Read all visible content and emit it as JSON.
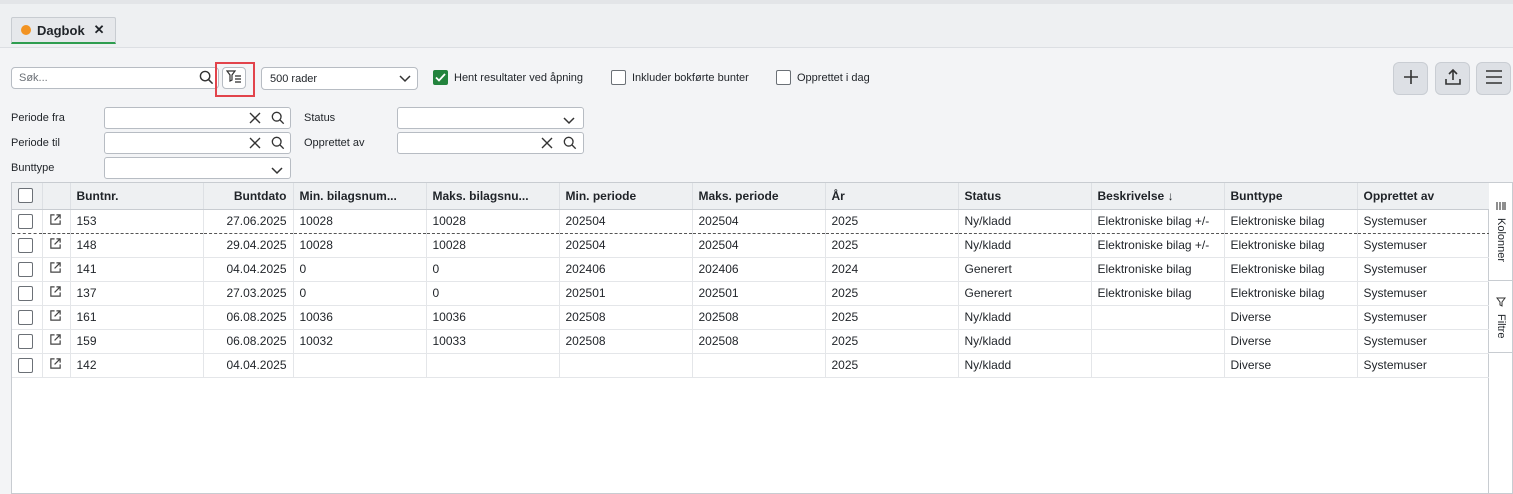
{
  "tab": {
    "label": "Dagbok",
    "close": "✕",
    "dot_color": "#f29322"
  },
  "toolbar": {
    "search_placeholder": "Søk...",
    "rows_select": "500 rader",
    "cb_fetch": {
      "label": "Hent resultater ved åpning",
      "checked": true
    },
    "cb_include": {
      "label": "Inkluder bokførte bunter",
      "checked": false
    },
    "cb_today": {
      "label": "Opprettet i dag",
      "checked": false
    }
  },
  "filters": {
    "periode_fra": "Periode fra",
    "periode_til": "Periode til",
    "bunttype": "Bunttype",
    "status": "Status",
    "opprettet_av": "Opprettet av"
  },
  "grid": {
    "columns": [
      "Buntnr.",
      "Buntdato",
      "Min. bilagsnum...",
      "Maks. bilagsnu...",
      "Min. periode",
      "Maks. periode",
      "År",
      "Status",
      "Beskrivelse",
      "Bunttype",
      "Opprettet av"
    ],
    "sort_indicator": "↓",
    "rows": [
      [
        "153",
        "27.06.2025",
        "10028",
        "10028",
        "202504",
        "202504",
        "2025",
        "Ny/kladd",
        "Elektroniske bilag +/-",
        "Elektroniske bilag",
        "Systemuser"
      ],
      [
        "148",
        "29.04.2025",
        "10028",
        "10028",
        "202504",
        "202504",
        "2025",
        "Ny/kladd",
        "Elektroniske bilag +/-",
        "Elektroniske bilag",
        "Systemuser"
      ],
      [
        "141",
        "04.04.2025",
        "0",
        "0",
        "202406",
        "202406",
        "2024",
        "Generert",
        "Elektroniske bilag",
        "Elektroniske bilag",
        "Systemuser"
      ],
      [
        "137",
        "27.03.2025",
        "0",
        "0",
        "202501",
        "202501",
        "2025",
        "Generert",
        "Elektroniske bilag",
        "Elektroniske bilag",
        "Systemuser"
      ],
      [
        "161",
        "06.08.2025",
        "10036",
        "10036",
        "202508",
        "202508",
        "2025",
        "Ny/kladd",
        "",
        "Diverse",
        "Systemuser"
      ],
      [
        "159",
        "06.08.2025",
        "10032",
        "10033",
        "202508",
        "202508",
        "2025",
        "Ny/kladd",
        "",
        "Diverse",
        "Systemuser"
      ],
      [
        "142",
        "04.04.2025",
        "",
        "",
        "",
        "",
        "2025",
        "Ny/kladd",
        "",
        "Diverse",
        "Systemuser"
      ]
    ]
  },
  "side_tabs": {
    "kolonner": "Kolonner",
    "filtre": "Filtre"
  },
  "colors": {
    "accent_green": "#23833d",
    "highlight_red": "#e2434b",
    "tab_dot": "#f29322"
  }
}
